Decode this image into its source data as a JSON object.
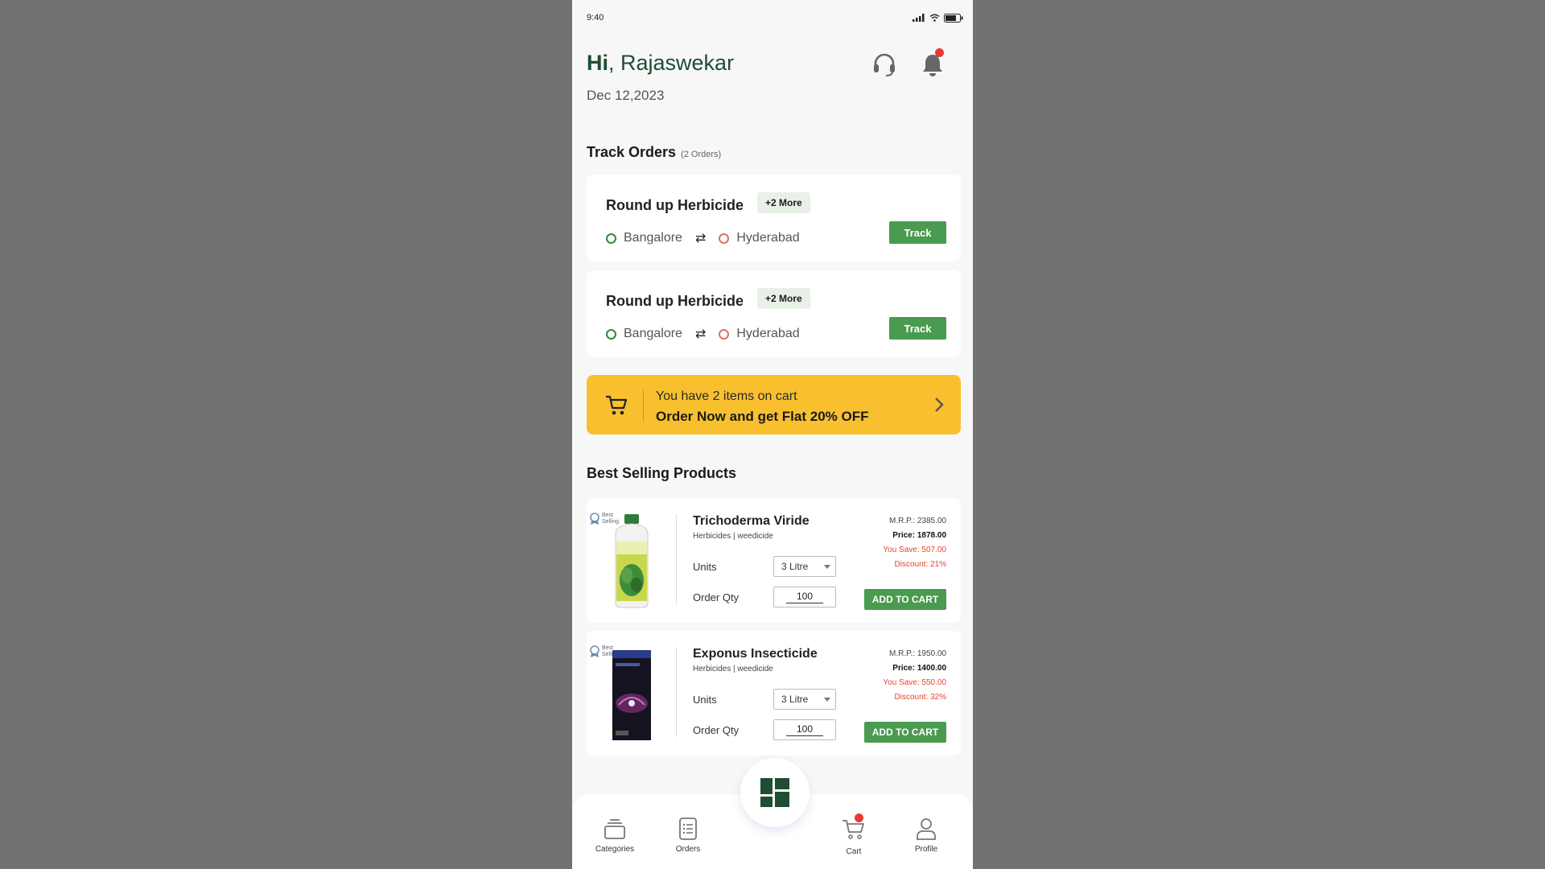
{
  "status_bar": {
    "time": "9:40"
  },
  "header": {
    "greeting_prefix": "Hi",
    "greeting_sep": ", ",
    "user_name": "Rajaswekar",
    "date": "Dec 12,2023"
  },
  "track_orders": {
    "title": "Track Orders",
    "count_label": "(2 Orders)",
    "orders": [
      {
        "name": "Round up Herbicide",
        "more": "+2 More",
        "from": "Bangalore",
        "to": "Hyderabad",
        "track_label": "Track"
      },
      {
        "name": "Round up Herbicide",
        "more": "+2 More",
        "from": "Bangalore",
        "to": "Hyderabad",
        "track_label": "Track"
      }
    ]
  },
  "cart_banner": {
    "line1": "You have 2 items on cart",
    "line2": "Order Now and get Flat 20% OFF"
  },
  "best_selling": {
    "title": "Best Selling Products",
    "tag": "Best Selling",
    "units_label": "Units",
    "qty_label": "Order Qty",
    "products": [
      {
        "name": "Trichoderma Viride",
        "category": "Herbicides | weedicide",
        "unit": "3 Litre",
        "qty": "100",
        "mrp": "M.R.P.: 2385.00",
        "price": "Price:  1878.00",
        "save": "You Save:  507.00",
        "discount": "Discount:  21%",
        "add_label": "ADD TO CART"
      },
      {
        "name": "Exponus Insecticide",
        "category": "Herbicides | weedicide",
        "unit": "3 Litre",
        "qty": "100",
        "mrp": "M.R.P.: 1950.00",
        "price": "Price:  1400.00",
        "save": "You Save:  550.00",
        "discount": "Discount:  32%",
        "add_label": "ADD TO CART"
      }
    ]
  },
  "bottom_nav": {
    "categories": "Categories",
    "orders": "Orders",
    "cart": "Cart",
    "profile": "Profile"
  },
  "colors": {
    "brand_green": "#4a9a4f",
    "dark_green": "#1f4d33",
    "banner_yellow": "#f8c02f",
    "alert_red": "#e53935"
  },
  "icons": [
    "signal-icon",
    "wifi-icon",
    "battery-icon",
    "headset-icon",
    "bell-icon",
    "cart-icon",
    "chevron-right-icon",
    "swap-arrows-icon",
    "grid-home-icon",
    "categories-icon",
    "orders-icon",
    "profile-icon",
    "best-selling-badge-icon"
  ]
}
